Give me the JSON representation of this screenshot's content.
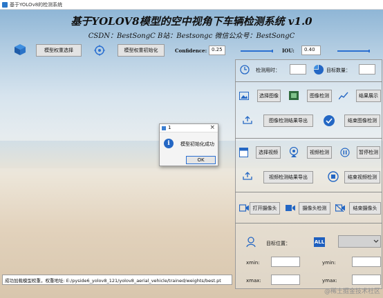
{
  "window": {
    "title": "基于YOLOv8的检测系统"
  },
  "header": {
    "title": "基于YOLOV8模型的空中视角下车辆检测系统 v1.0",
    "subtitle": "CSDN：BestSongC   B站：Bestsongc   微信公众号：BestSongC"
  },
  "toolbar": {
    "select_weights": "模型权重选择",
    "init_weights": "模型权重初始化",
    "confidence_label": "Confidence:",
    "confidence_value": "0.25",
    "iou_label": "IOU:",
    "iou_value": "0.40"
  },
  "stats": {
    "time_label": "检测用时：",
    "count_label": "目标数量："
  },
  "image_row": {
    "select": "选择图像",
    "detect": "图像检测",
    "show": "结果展示"
  },
  "export_row": {
    "export": "图像检测结果导出",
    "end": "结束图像检测"
  },
  "video_row": {
    "select": "选择视频",
    "detect": "视频检测",
    "pause": "暂停检测"
  },
  "video_export_row": {
    "export": "视频检测结果导出",
    "end": "结束视频检测"
  },
  "camera_row": {
    "open": "打开摄像头",
    "detect": "摄像头检测",
    "end": "结束摄像头"
  },
  "target": {
    "position_label": "目标位置：",
    "all_badge": "ALL",
    "xmin": "xmin:",
    "ymin": "ymin:",
    "xmax": "xmax:",
    "ymax": "ymax:"
  },
  "status": "成功加载模型权重，权重地址: E:/pyside6_yolov8_121/yolov8_aerial_vehicle/trained/weights/best.pt",
  "watermark": "@稀土掘金技术社区",
  "dialog": {
    "title": "1",
    "message": "模型初始化成功",
    "ok": "OK"
  },
  "colors": {
    "accent": "#2a6fd1",
    "icon_blue": "#2467c4"
  },
  "icons": [
    "cube-icon",
    "target-icon",
    "clock-icon",
    "pie-chart-icon",
    "image-icon",
    "film-icon",
    "trend-icon",
    "upload-icon",
    "check-circle-icon",
    "video-file-icon",
    "webcam-icon",
    "pause-icon",
    "stop-icon",
    "camera-icon",
    "person-icon"
  ]
}
